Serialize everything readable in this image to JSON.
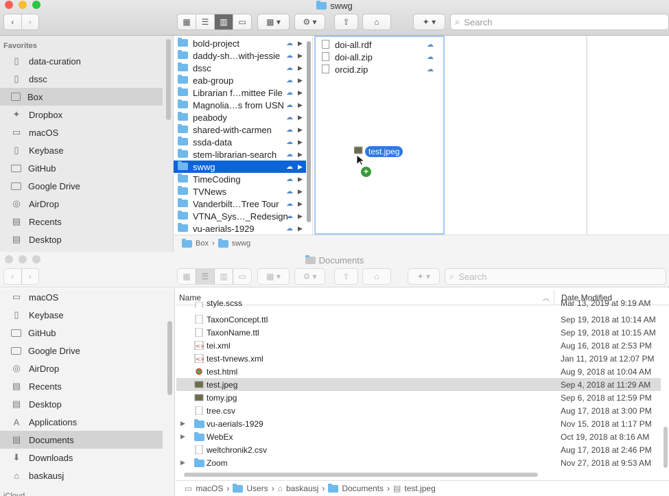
{
  "top_window": {
    "title": "swwg",
    "toolbar": {
      "search_placeholder": "Search"
    },
    "sidebar": {
      "header": "Favorites",
      "items": [
        {
          "label": "data-curation",
          "icon": "doc-icon"
        },
        {
          "label": "dssc",
          "icon": "doc-icon"
        },
        {
          "label": "Box",
          "icon": "box-icon",
          "selected": true
        },
        {
          "label": "Dropbox",
          "icon": "dropbox-icon"
        },
        {
          "label": "macOS",
          "icon": "disk-icon"
        },
        {
          "label": "Keybase",
          "icon": "doc-icon"
        },
        {
          "label": "GitHub",
          "icon": "folder-icon"
        },
        {
          "label": "Google Drive",
          "icon": "folder-icon"
        },
        {
          "label": "AirDrop",
          "icon": "airdrop-icon"
        },
        {
          "label": "Recents",
          "icon": "recents-icon"
        },
        {
          "label": "Desktop",
          "icon": "desktop-icon"
        }
      ]
    },
    "column1": [
      {
        "label": "bold-project"
      },
      {
        "label": "daddy-sh…with-jessie"
      },
      {
        "label": "dssc"
      },
      {
        "label": "eab-group"
      },
      {
        "label": "Librarian f…mittee File"
      },
      {
        "label": "Magnolia…s from USN"
      },
      {
        "label": "peabody"
      },
      {
        "label": "shared-with-carmen"
      },
      {
        "label": "ssda-data"
      },
      {
        "label": "stem-librarian-search"
      },
      {
        "label": "swwg",
        "selected": true
      },
      {
        "label": "TimeCoding"
      },
      {
        "label": "TVNews"
      },
      {
        "label": "Vanderbilt…Tree Tour"
      },
      {
        "label": "VTNA_Sys…_Redesign"
      },
      {
        "label": "vu-aerials-1929"
      }
    ],
    "column2": [
      {
        "label": "doi-all.rdf"
      },
      {
        "label": "doi-all.zip"
      },
      {
        "label": "orcid.zip"
      }
    ],
    "drag_label": "test.jpeg",
    "pathbar": [
      "Box",
      "swwg"
    ]
  },
  "bottom_window": {
    "title": "Documents",
    "toolbar": {
      "search_placeholder": "Search"
    },
    "sidebar": {
      "items": [
        {
          "label": "macOS",
          "icon": "disk-icon"
        },
        {
          "label": "Keybase",
          "icon": "doc-icon"
        },
        {
          "label": "GitHub",
          "icon": "folder-icon"
        },
        {
          "label": "Google Drive",
          "icon": "folder-icon"
        },
        {
          "label": "AirDrop",
          "icon": "airdrop-icon"
        },
        {
          "label": "Recents",
          "icon": "recents-icon"
        },
        {
          "label": "Desktop",
          "icon": "desktop-icon"
        },
        {
          "label": "Applications",
          "icon": "applications-icon"
        },
        {
          "label": "Documents",
          "icon": "documents-icon",
          "selected": true
        },
        {
          "label": "Downloads",
          "icon": "downloads-icon"
        },
        {
          "label": "baskausj",
          "icon": "home-icon"
        }
      ],
      "cut_header": "iCloud"
    },
    "columns": {
      "name": "Name",
      "date": "Date Modified"
    },
    "rows": [
      {
        "name": "style.scss",
        "date": "Mar 13, 2019 at 9:19 AM",
        "kind": "file"
      },
      {
        "name": "TaxonConcept.ttl",
        "date": "Sep 19, 2018 at 10:14 AM",
        "kind": "file"
      },
      {
        "name": "TaxonName.ttl",
        "date": "Sep 19, 2018 at 10:15 AM",
        "kind": "file"
      },
      {
        "name": "tei.xml",
        "date": "Aug 16, 2018 at 2:53 PM",
        "kind": "xml"
      },
      {
        "name": "test-tvnews.xml",
        "date": "Jan 11, 2019 at 12:07 PM",
        "kind": "xml"
      },
      {
        "name": "test.html",
        "date": "Aug 9, 2018 at 10:04 AM",
        "kind": "html"
      },
      {
        "name": "test.jpeg",
        "date": "Sep 4, 2018 at 11:29 AM",
        "kind": "image",
        "selected": true
      },
      {
        "name": "tomy.jpg",
        "date": "Sep 6, 2018 at 12:59 PM",
        "kind": "image"
      },
      {
        "name": "tree.csv",
        "date": "Aug 17, 2018 at 3:00 PM",
        "kind": "file"
      },
      {
        "name": "vu-aerials-1929",
        "date": "Nov 15, 2018 at 1:17 PM",
        "kind": "folder"
      },
      {
        "name": "WebEx",
        "date": "Oct 19, 2018 at 8:16 AM",
        "kind": "folder"
      },
      {
        "name": "weltchronik2.csv",
        "date": "Aug 17, 2018 at 2:46 PM",
        "kind": "file"
      },
      {
        "name": "Zoom",
        "date": "Nov 27, 2018 at 9:53 AM",
        "kind": "folder"
      }
    ],
    "pathbar": [
      "macOS",
      "Users",
      "baskausj",
      "Documents",
      "test.jpeg"
    ]
  },
  "colors": {
    "selection": "#0d64d8",
    "folder": "#6fb9ec",
    "sidebar_bg": "#eaeaea"
  }
}
